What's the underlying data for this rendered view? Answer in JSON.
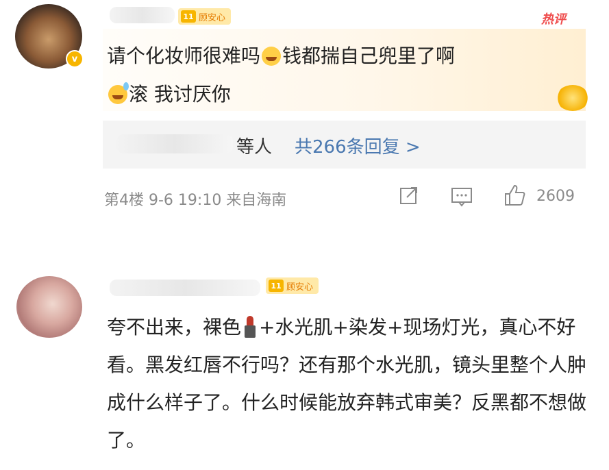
{
  "comment1": {
    "level": "11",
    "badge": "顾安心",
    "hot_label": "热评",
    "text_a": "请个化妆师很难吗",
    "text_b": "钱都揣自己兜里了啊",
    "text_c": "滚 我讨厌你",
    "replies_others": "等人",
    "replies_count": "共266条回复 >",
    "meta": "第4楼  9-6 19:10  来自海南",
    "likes": "2609"
  },
  "comment2": {
    "level": "11",
    "badge": "顾安心",
    "text_a": "夸不出来，裸色",
    "text_b": "+水光肌+染发+现场灯光，真心不好看。黑发红唇不行吗？还有那个水光肌，镜头里整个人肿成什么样子了。什么时候能放弃韩式审美？反黑都不想做了。"
  }
}
